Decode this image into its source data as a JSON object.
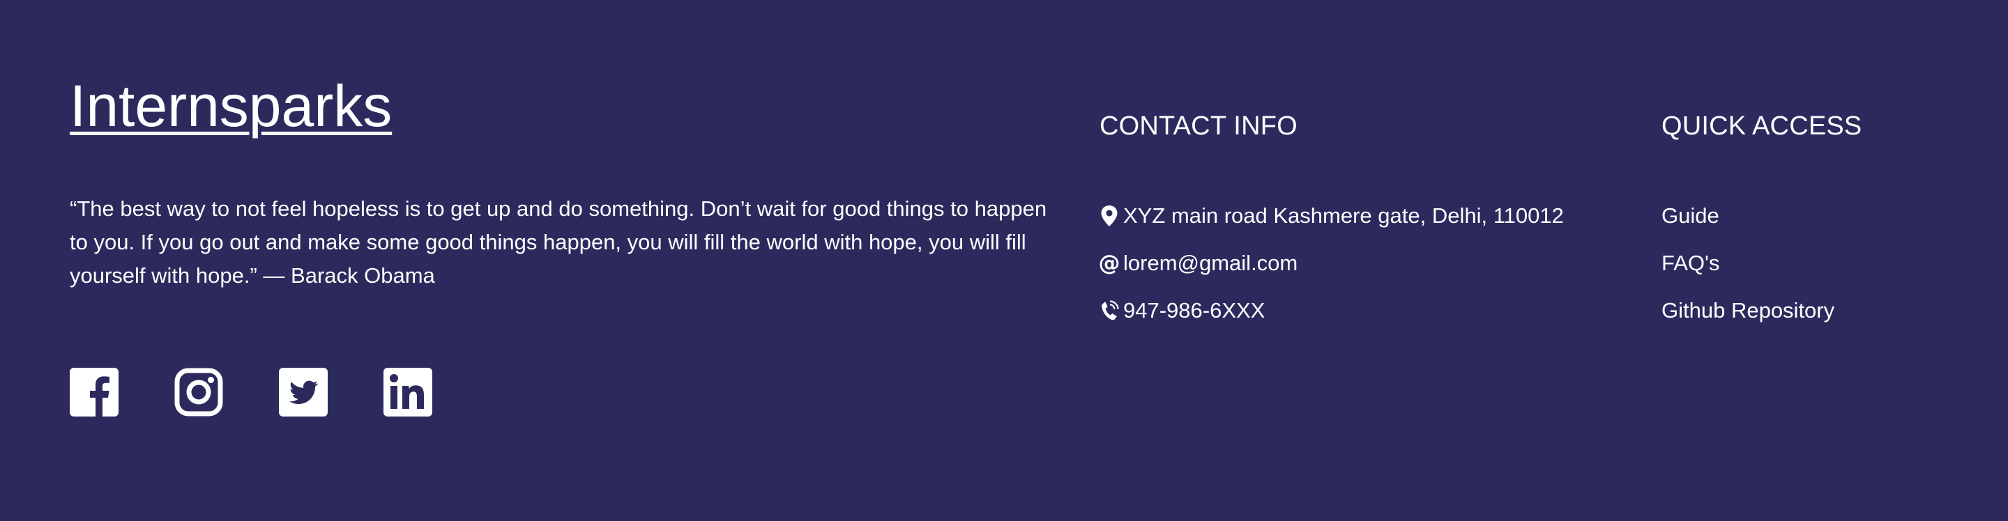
{
  "brand": {
    "name": "Internsparks"
  },
  "quote": {
    "text": "“The best way to not feel hopeless is to get up and do something. Don’t wait for good things to happen to you. If you go out and make some good things happen, you will fill the world with hope, you will fill yourself with hope.” — Barack Obama"
  },
  "socials": [
    {
      "icon": "facebook-icon"
    },
    {
      "icon": "instagram-icon"
    },
    {
      "icon": "twitter-icon"
    },
    {
      "icon": "linkedin-icon"
    }
  ],
  "contact": {
    "title": "CONTACT INFO",
    "address": "XYZ main road Kashmere gate, Delhi, 110012",
    "email": "lorem@gmail.com",
    "phone": "947-986-6XXX",
    "icons": {
      "address": "location-pin-icon",
      "email": "at-sign-icon",
      "phone": "phone-icon"
    }
  },
  "quick_access": {
    "title": "QUICK ACCESS",
    "links": [
      {
        "label": "Guide"
      },
      {
        "label": "FAQ's"
      },
      {
        "label": "Github Repository"
      }
    ]
  },
  "colors": {
    "background": "#2c2a5d",
    "text": "#ffffff"
  }
}
